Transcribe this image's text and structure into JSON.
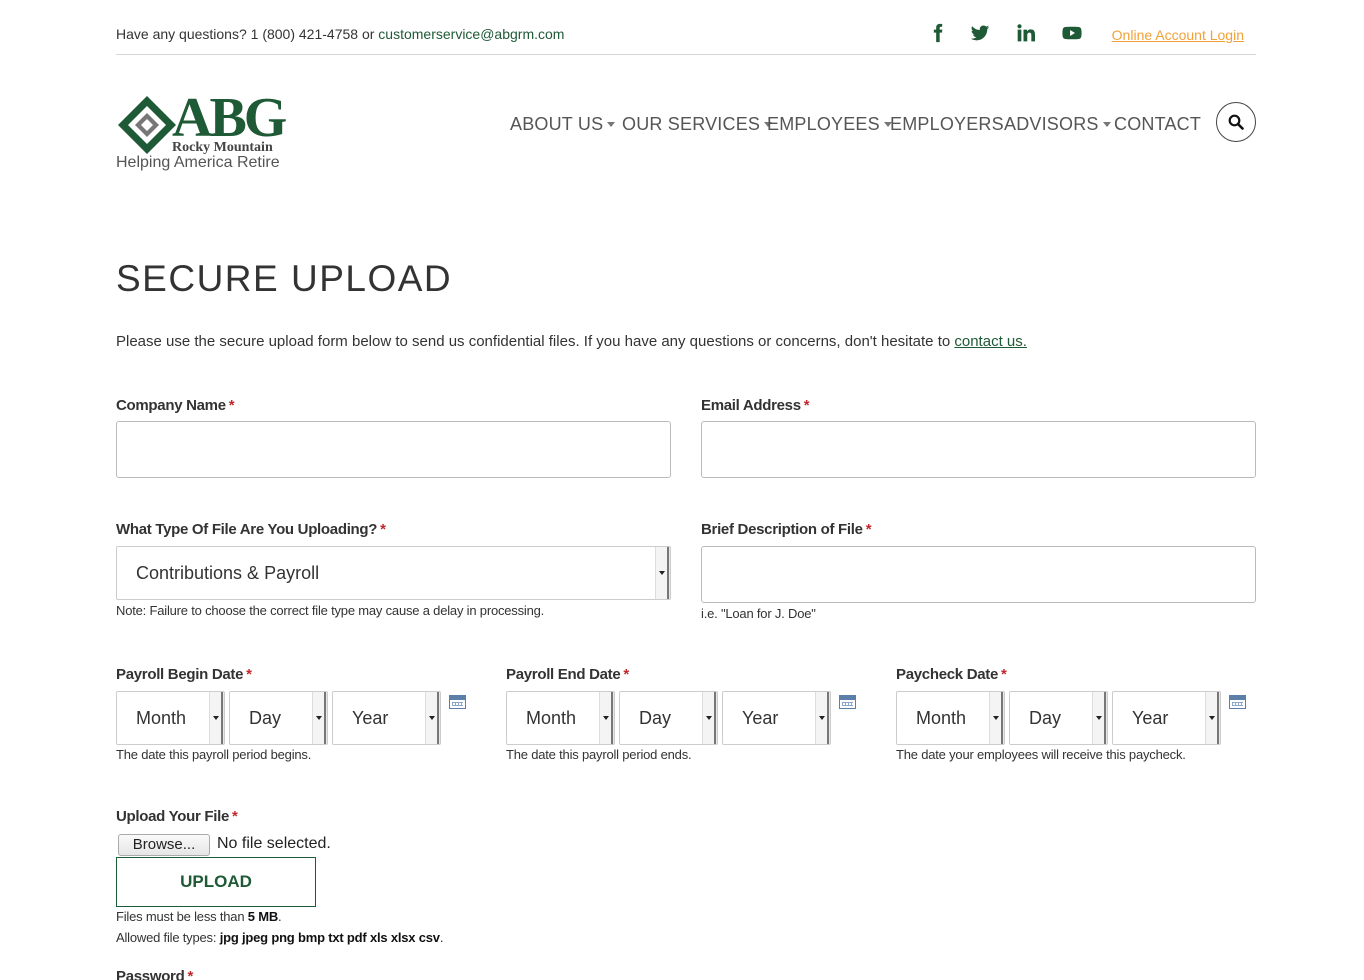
{
  "topbar": {
    "questions_text": "Have any questions? 1 (800) 421-4758 or",
    "email": "customerservice@abgrm.com",
    "social": [
      "facebook-icon",
      "twitter-icon",
      "linkedin-icon",
      "youtube-icon"
    ],
    "login_link": "Online Account Login"
  },
  "logo": {
    "letters": "ABG",
    "subtitle": "Rocky Mountain",
    "tagline": "Helping America Retire"
  },
  "nav": [
    {
      "label": "ABOUT US",
      "dropdown": true
    },
    {
      "label": "OUR SERVICES",
      "dropdown": true
    },
    {
      "label": "EMPLOYEES",
      "dropdown": true
    },
    {
      "label": "EMPLOYERS",
      "dropdown": false
    },
    {
      "label": "ADVISORS",
      "dropdown": true
    },
    {
      "label": "CONTACT",
      "dropdown": false
    }
  ],
  "page": {
    "title": "SECURE UPLOAD",
    "intro_text": "Please use the secure upload form below to send us confidential files. If you have any questions or concerns, don't hesitate to",
    "intro_link": "contact us."
  },
  "form": {
    "required_mark": "*",
    "company_label": "Company Name",
    "company_value": "",
    "email_label": "Email Address",
    "email_value": "",
    "filetype_label": "What Type Of File Are You Uploading?",
    "filetype_value": "Contributions & Payroll",
    "filetype_note": "Note: Failure to choose the correct file type may cause a delay in processing.",
    "description_label": "Brief Description of File",
    "description_value": "",
    "description_hint": "i.e. \"Loan for J. Doe\"",
    "dates": {
      "begin": {
        "label": "Payroll Begin Date",
        "month": "Month",
        "day": "Day",
        "year": "Year",
        "help": "The date this payroll period begins."
      },
      "end": {
        "label": "Payroll End Date",
        "month": "Month",
        "day": "Day",
        "year": "Year",
        "help": "The date this payroll period ends."
      },
      "paycheck": {
        "label": "Paycheck Date",
        "month": "Month",
        "day": "Day",
        "year": "Year",
        "help": "The date your employees will receive this paycheck."
      }
    },
    "upload_label": "Upload Your File",
    "browse_label": "Browse...",
    "no_file_text": "No file selected.",
    "upload_button": "UPLOAD",
    "size_prefix": "Files must be less than",
    "size_value": "5 MB",
    "size_suffix": ".",
    "types_prefix": "Allowed file types:",
    "types_value": "jpg jpeg png bmp txt pdf xls xlsx csv",
    "types_suffix": ".",
    "password_label": "Password"
  },
  "colors": {
    "brand_green": "#1f5a36",
    "login_orange": "#f0a23a",
    "required_red": "#c0282d"
  }
}
